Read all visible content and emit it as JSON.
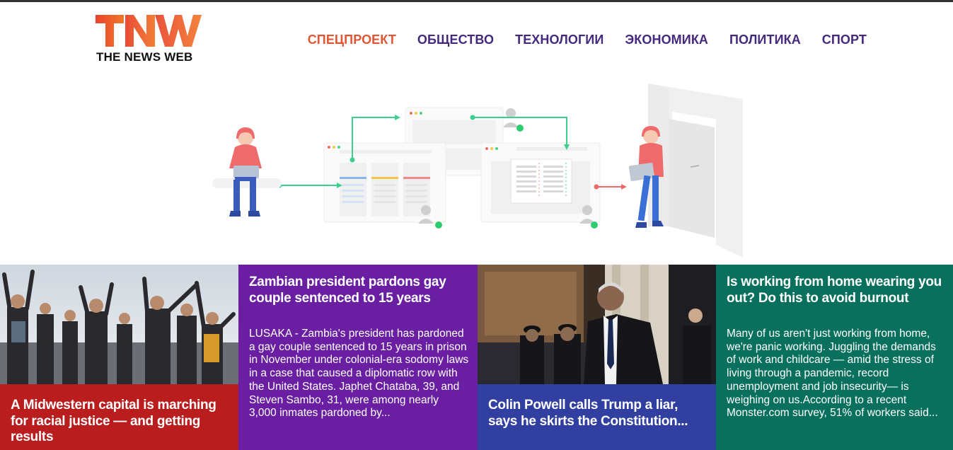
{
  "site": {
    "logo_mark": "TNW",
    "logo_subtitle": "THE NEWS WEB",
    "brand_colors": {
      "primary": "#e05633",
      "secondary": "#f07a2b",
      "nav": "#45297d"
    }
  },
  "nav": {
    "items": [
      {
        "label": "СПЕЦПРОЕКТ",
        "active": true
      },
      {
        "label": "ОБЩЕСТВО",
        "active": false
      },
      {
        "label": "ТЕХНОЛОГИИ",
        "active": false
      },
      {
        "label": "ЭКОНОМИКА",
        "active": false
      },
      {
        "label": "ПОЛИТИКА",
        "active": false
      },
      {
        "label": "СПОРТ",
        "active": false
      }
    ]
  },
  "hero": {
    "illustration": "workflow-illustration"
  },
  "cards": [
    {
      "title": "A Midwestern capital is marching for racial justice — and getting results",
      "image": "protest-photo",
      "color": "#b91d1d"
    },
    {
      "title": "Zambian president pardons gay couple sentenced to 15 years",
      "text": "LUSAKA - Zambia's president has pardoned a gay couple sentenced to 15 years in prison in November under colonial-era sodomy laws in a case that caused a diplomatic row with the United States. Japhet Chataba, 39, and Steven Sambo, 31, were among nearly 3,000 inmates pardoned by...",
      "color": "#6a1fa2"
    },
    {
      "title": "Colin Powell calls Trump a liar, says he skirts the Constitution...",
      "image": "colin-powell-photo",
      "color": "#3140a0"
    },
    {
      "title": "Is working from home wearing you out? Do this to avoid burnout",
      "text": "Many of us aren't just working from home, we're panic working. Juggling the demands of work and childcare — amid the stress of living through a pandemic, record unemployment and job insecurity— is weighing on us.According to a recent Monster.com survey, 51% of workers said...",
      "color": "#08705c"
    }
  ]
}
